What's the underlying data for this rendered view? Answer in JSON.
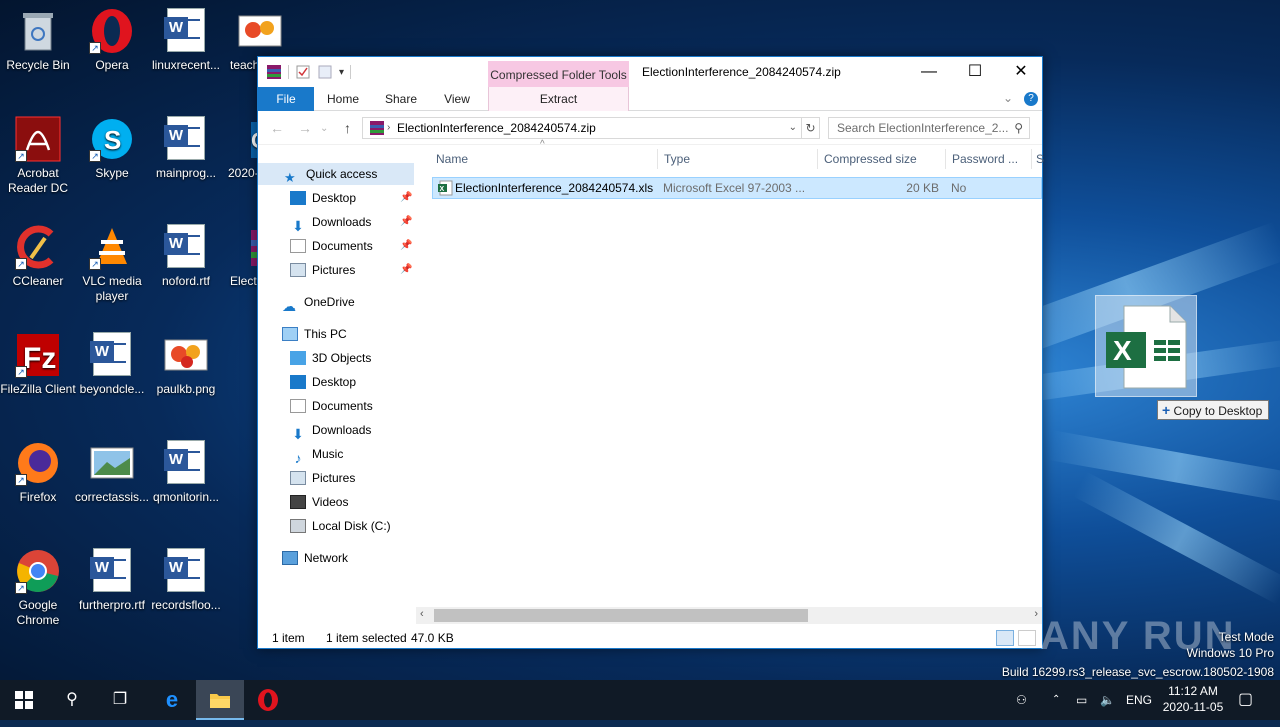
{
  "desktop": {
    "icons": [
      {
        "label": "Recycle Bin"
      },
      {
        "label": "Opera"
      },
      {
        "label": "linuxrecent..."
      },
      {
        "label": "teach"
      },
      {
        "label": "Acrobat Reader DC"
      },
      {
        "label": "Skype"
      },
      {
        "label": "mainprog..."
      },
      {
        "label": "2020-"
      },
      {
        "label": "CCleaner"
      },
      {
        "label": "VLC media player"
      },
      {
        "label": "noford.rtf"
      },
      {
        "label": "Electi"
      },
      {
        "label": "FileZilla Client"
      },
      {
        "label": "beyondcle..."
      },
      {
        "label": "paulkb.png"
      },
      {
        "label": "Firefox"
      },
      {
        "label": "correctassis..."
      },
      {
        "label": "qmonitorin..."
      },
      {
        "label": "Google Chrome"
      },
      {
        "label": "furtherpro.rtf"
      },
      {
        "label": "recordsfloo..."
      }
    ]
  },
  "window": {
    "title": "ElectionInterference_2084240574.zip",
    "context_tab_group": "Compressed Folder Tools",
    "ribbon_tabs": [
      "File",
      "Home",
      "Share",
      "View",
      "Extract"
    ],
    "address": "ElectionInterference_2084240574.zip",
    "search_placeholder": "Search ElectionInterference_2...",
    "nav": {
      "quick_access": "Quick access",
      "quick_items": [
        "Desktop",
        "Downloads",
        "Documents",
        "Pictures"
      ],
      "onedrive": "OneDrive",
      "this_pc": "This PC",
      "pc_items": [
        "3D Objects",
        "Desktop",
        "Documents",
        "Downloads",
        "Music",
        "Pictures",
        "Videos",
        "Local Disk (C:)"
      ],
      "network": "Network"
    },
    "columns": [
      "Name",
      "Type",
      "Compressed size",
      "Password ...",
      "Si"
    ],
    "files": [
      {
        "name": "ElectionInterference_2084240574.xls",
        "type": "Microsoft Excel 97-2003 ...",
        "compressed_size": "20 KB",
        "password": "No"
      }
    ],
    "status": {
      "count": "1 item",
      "selected": "1 item selected",
      "size": "47.0 KB"
    }
  },
  "drag": {
    "tooltip": "Copy to Desktop",
    "icon": "excel-file-icon"
  },
  "watermark": {
    "brand": "ANY RUN",
    "lines": [
      "Test Mode",
      "Windows 10 Pro",
      "Build 16299.rs3_release_svc_escrow.180502-1908"
    ]
  },
  "taskbar": {
    "lang": "ENG",
    "time": "11:12 AM",
    "date": "2020-11-05"
  },
  "colors": {
    "accent": "#1979ca",
    "context_tab": "#f7c8e3",
    "selection": "#cce8ff"
  }
}
